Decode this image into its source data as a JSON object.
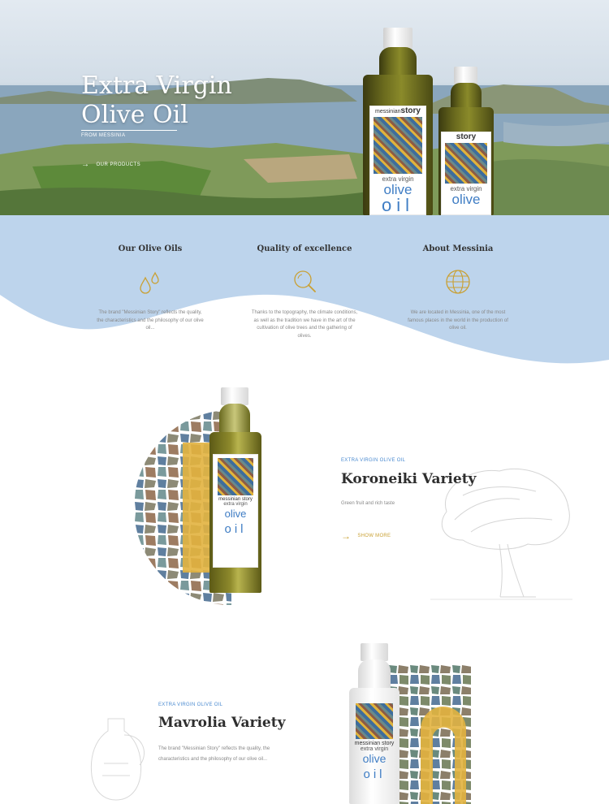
{
  "hero": {
    "title_line1": "Extra Virgin",
    "title_line2": "Olive Oil",
    "subtitle": "FROM MESSINIA",
    "cta": "OUR PRODUCTS"
  },
  "bottle_label": {
    "brand_small": "messinian",
    "brand_big": "story",
    "extra": "extra virgin",
    "olive": "olive",
    "oil": "oil"
  },
  "features": [
    {
      "title": "Our Olive Oils",
      "icon": "droplets-icon",
      "text": "The brand \"Messinian Story\" reflects the quality, the characteristics and the philosophy of our olive oil..."
    },
    {
      "title": "Quality of excellence",
      "icon": "magnifier-icon",
      "text": "Thanks to the topography, the climate conditions, as well as the tradition we have in the art of the cultivation of olive trees and the gathering of olives."
    },
    {
      "title": "About Messinia",
      "icon": "globe-icon",
      "text": "We are located in Messinia, one of the most famous places in the world in the production of olive oil."
    }
  ],
  "product1": {
    "tag": "EXTRA VIRGIN OLIVE OIL",
    "title": "Koroneiki Variety",
    "description": "Green fruit and rich taste",
    "cta": "SHOW MORE"
  },
  "product2": {
    "tag": "EXTRA VIRGIN OLIVE OIL",
    "title": "Mavrolia Variety",
    "description": "The brand \"Messinian Story\" reflects the quality, the characteristics and the philosophy of our olive oil..."
  },
  "colors": {
    "wave_blue": "#bdd4ec",
    "gold": "#c9a033",
    "label_blue": "#3f7dc4",
    "tag_blue": "#4a8ad0"
  }
}
